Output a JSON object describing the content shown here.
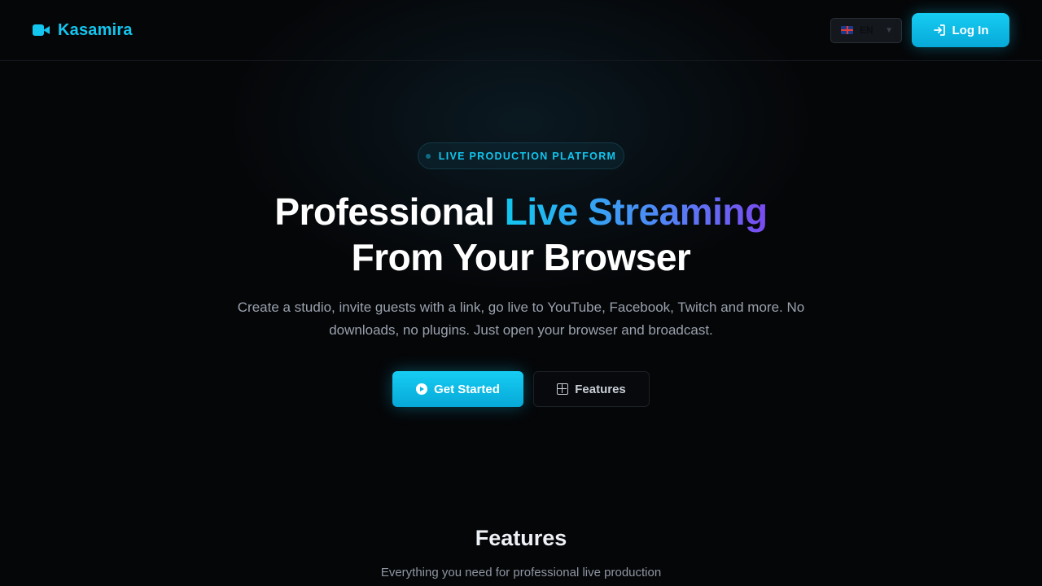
{
  "brand": {
    "name": "Kasamira",
    "icon": "video-camera-icon",
    "color": "#12c6ef"
  },
  "header": {
    "language": {
      "code": "EN",
      "flag": "uk-flag-icon",
      "options_visible": [
        "EN"
      ]
    },
    "login_label": "Log In",
    "login_icon": "log-in-icon"
  },
  "hero": {
    "badge": "LIVE PRODUCTION PLATFORM",
    "headline_part1": "Professional",
    "headline_highlight": "Live Streaming",
    "headline_line2": "From Your Browser",
    "subtitle": "Create a studio, invite guests with a link, go live to YouTube, Facebook, Twitch and more. No downloads, no plugins. Just open your browser and broadcast.",
    "primary_cta": "Get Started",
    "primary_cta_icon": "play-circle-icon",
    "secondary_cta": "Features",
    "secondary_cta_icon": "grid-icon"
  },
  "features": {
    "title": "Features",
    "subtitle": "Everything you need for professional live production"
  },
  "colors": {
    "accent": "#12c6ef",
    "gradient_start": "#12c6ef",
    "gradient_end": "#7a4af0",
    "background": "#050608"
  }
}
